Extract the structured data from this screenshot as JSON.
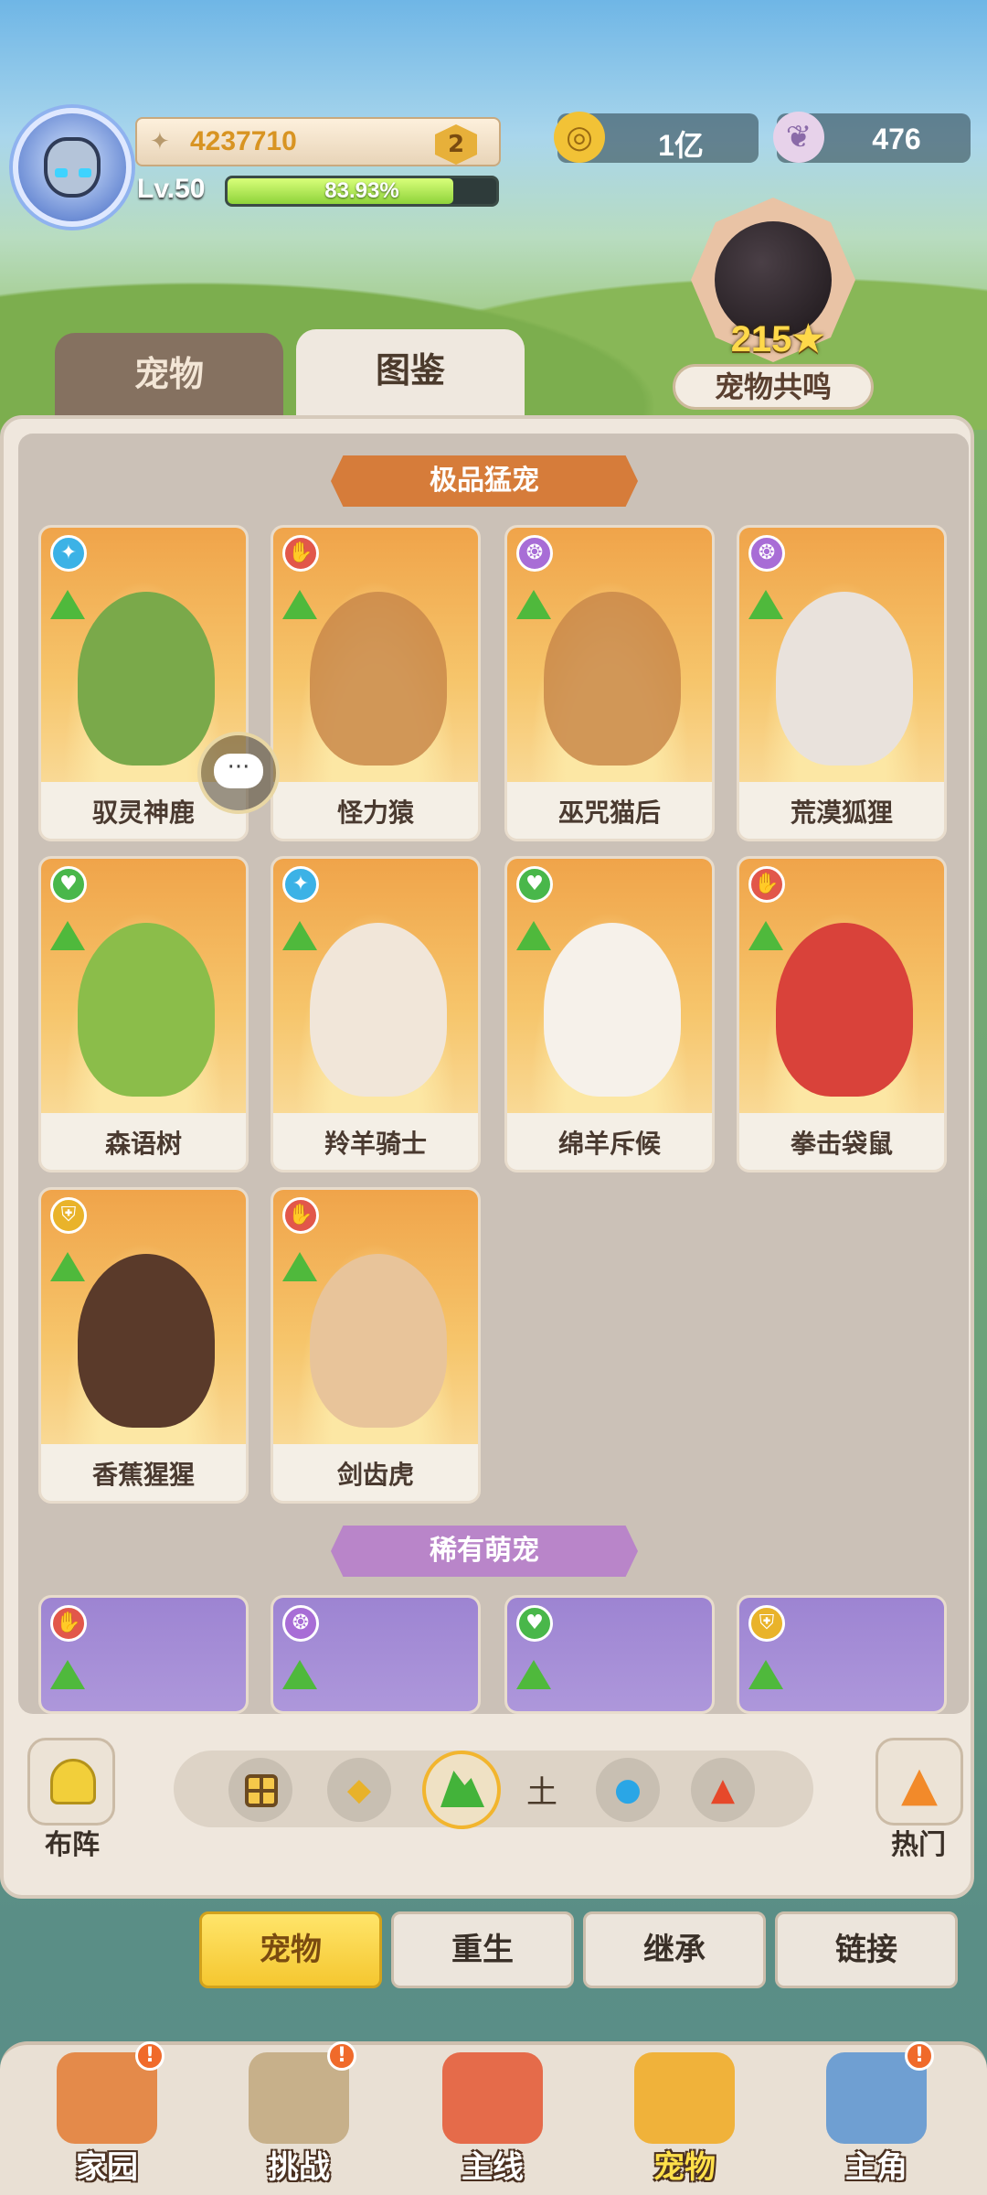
{
  "header": {
    "power": "4237710",
    "rank_badge": "2",
    "level": "Lv.50",
    "exp_percent_text": "83.93%",
    "exp_fraction": 0.8393,
    "gold": "1亿",
    "shells": "476"
  },
  "resonance": {
    "stars": "215",
    "label": "宠物共鸣"
  },
  "top_tabs": {
    "pets": "宠物",
    "dex": "图鉴"
  },
  "sections": {
    "epic": "极品猛宠",
    "rare": "稀有萌宠"
  },
  "epic_pets": [
    {
      "name": "驭灵神鹿",
      "element": "blue",
      "owned": true
    },
    {
      "name": "怪力猿",
      "element": "red",
      "owned": false
    },
    {
      "name": "巫咒猫后",
      "element": "purple",
      "owned": false
    },
    {
      "name": "荒漠狐狸",
      "element": "purple",
      "owned": true
    },
    {
      "name": "森语树",
      "element": "green",
      "owned": true
    },
    {
      "name": "羚羊骑士",
      "element": "blue",
      "owned": true
    },
    {
      "name": "绵羊斥候",
      "element": "green",
      "owned": true
    },
    {
      "name": "拳击袋鼠",
      "element": "red",
      "owned": true
    },
    {
      "name": "香蕉猩猩",
      "element": "gold",
      "owned": true
    },
    {
      "name": "剑齿虎",
      "element": "red",
      "owned": true
    }
  ],
  "rare_pets": [
    {
      "element": "red"
    },
    {
      "element": "purple"
    },
    {
      "element": "green"
    },
    {
      "element": "gold"
    }
  ],
  "filters": {
    "earth_label": "土",
    "formation": "布阵",
    "hot": "热门"
  },
  "actions": {
    "pets": "宠物",
    "rebirth": "重生",
    "inherit": "继承",
    "link": "链接"
  },
  "nav": {
    "home": "家园",
    "challenge": "挑战",
    "main": "主线",
    "pet": "宠物",
    "hero": "主角",
    "alert": "!"
  },
  "colors": {
    "accent_yellow": "#f5c730",
    "epic_banner": "#d67c3a",
    "rare_banner": "#b985c9",
    "earth_green": "#43b33a"
  }
}
